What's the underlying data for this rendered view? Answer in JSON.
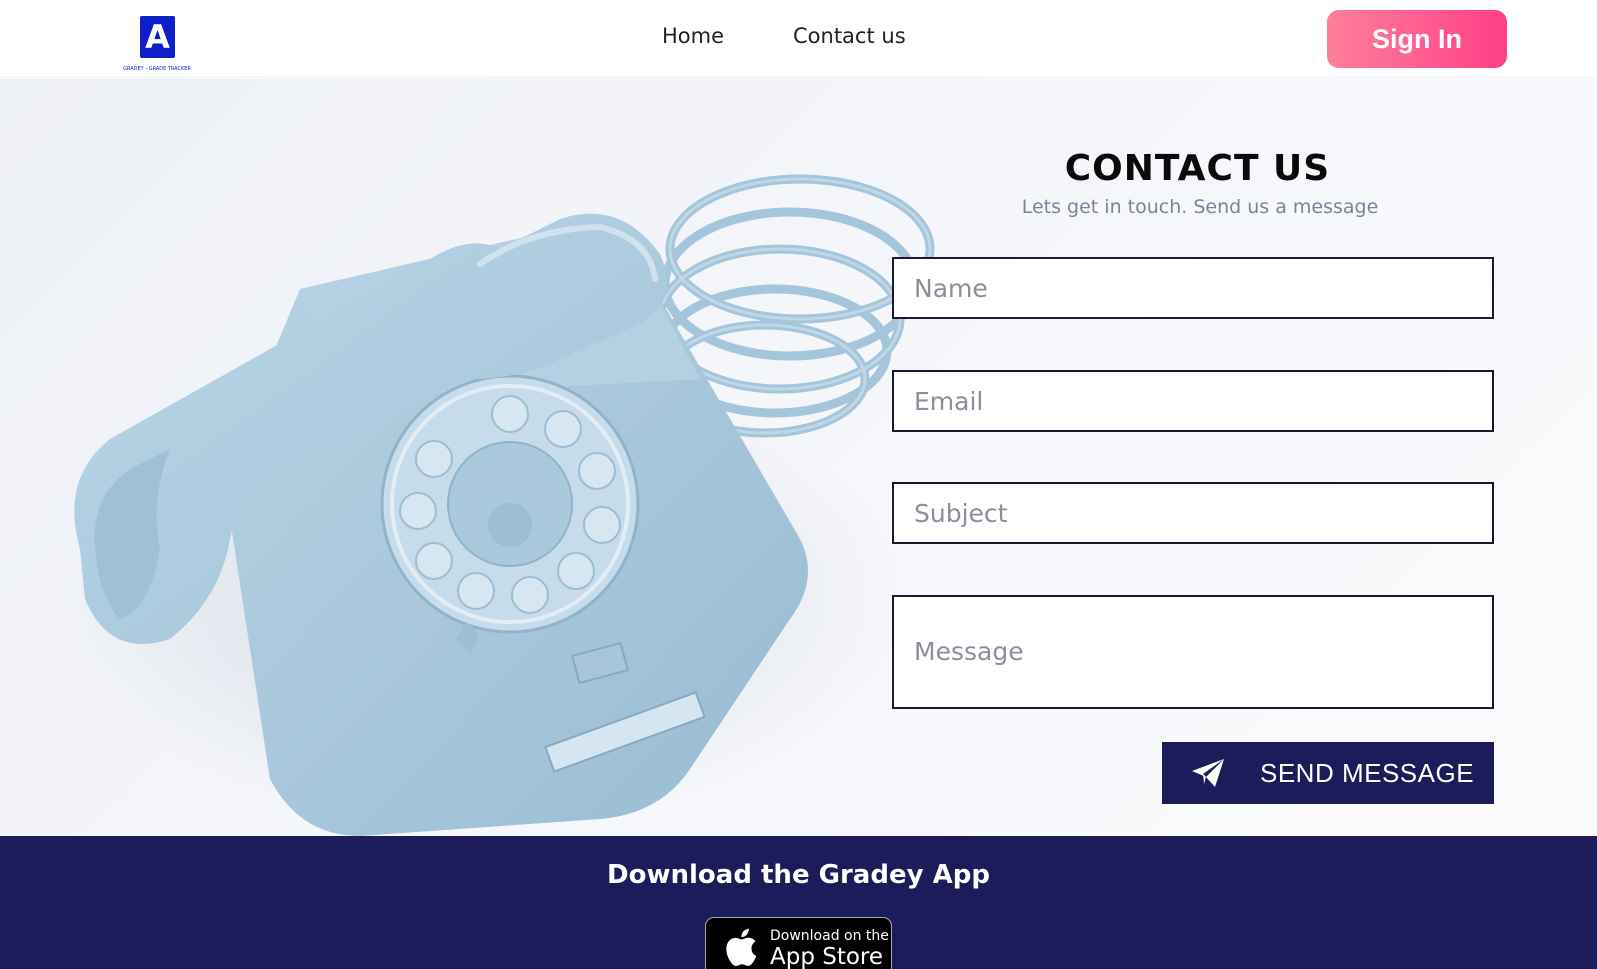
{
  "header": {
    "logo_letter": "A",
    "logo_caption": "GRADEY - GRADE TRACKER",
    "nav": [
      {
        "label": "Home"
      },
      {
        "label": "Contact us"
      }
    ],
    "sign_in_label": "Sign In"
  },
  "contact": {
    "title": "CONTACT US",
    "subtitle": "Lets get in touch. Send us a message",
    "fields": {
      "name_placeholder": "Name",
      "email_placeholder": "Email",
      "subject_placeholder": "Subject",
      "message_placeholder": "Message"
    },
    "send_label": "SEND MESSAGE"
  },
  "footer": {
    "title": "Download the Gradey App",
    "store_small": "Download on the",
    "store_big": "App Store"
  },
  "icons": {
    "send": "paper-plane-icon",
    "store": "apple-icon",
    "hero": "rotary-telephone-illustration"
  },
  "colors": {
    "navy": "#1c1c5a",
    "brand_blue": "#0f1fc7",
    "signin_gradient_start": "#fd7f9b",
    "signin_gradient_end": "#fe3f86",
    "phone_blue": "#a8c6da"
  }
}
